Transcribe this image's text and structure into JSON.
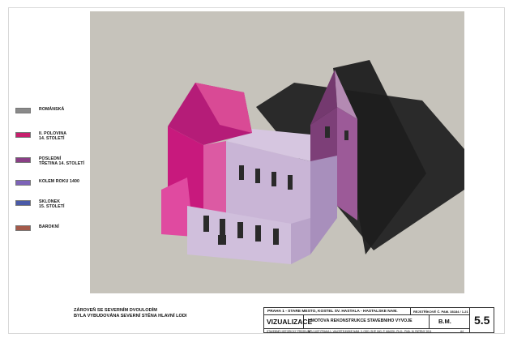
{
  "legend": [
    {
      "label": "ROMÁNSKÁ",
      "color": "#8a8a8a"
    },
    {
      "label": "II. POLOVINA\n14. STOLETÍ",
      "color": "#c71f6d"
    },
    {
      "label": "POSLEDNÍ\nTŘETINA 14. STOLETÍ",
      "color": "#8a3f86"
    },
    {
      "label": "KOLEM ROKU 1400",
      "color": "#7c63b8"
    },
    {
      "label": "SKLONEK\n15. STOLETÍ",
      "color": "#4a5aa8"
    },
    {
      "label": "BAROKNÍ",
      "color": "#a45a4a"
    }
  ],
  "note": "ZÁROVEŇ SE SEVERNÍM DVOULODÍM\nBYLA VYBUDOVÁNA  SEVERNÍ STĚNA HLAVNÍ LODI",
  "title_block": {
    "project": "PRAHA 1 - STARÉ MĚSTO, KOSTEL SV. HAŠTALA - HAŠTALSKÉ NÁM.",
    "reg": "REJSTŘÍKOVÉ Č. PAM.  38184 / 1-21",
    "drawing_title": "VIZUALIZACE",
    "subtitle": "HMOTOVÁ REKONSTRUKCE STAVEBNÍHO VÝVOJE",
    "author": "B.M.",
    "sheet": "5.5",
    "small_left": "STAVEBNĚ HISTORICKÝ PRŮZKUM",
    "small_mid": "NPÚ ÚOP PRAHA 1, VALDŠTEJNSKÉ NÁM. 3, ODD. SHP, ING. P. MACEK, Ph.D., PhDr. M. PATRNÝ    2011",
    "small_right": "A4"
  }
}
